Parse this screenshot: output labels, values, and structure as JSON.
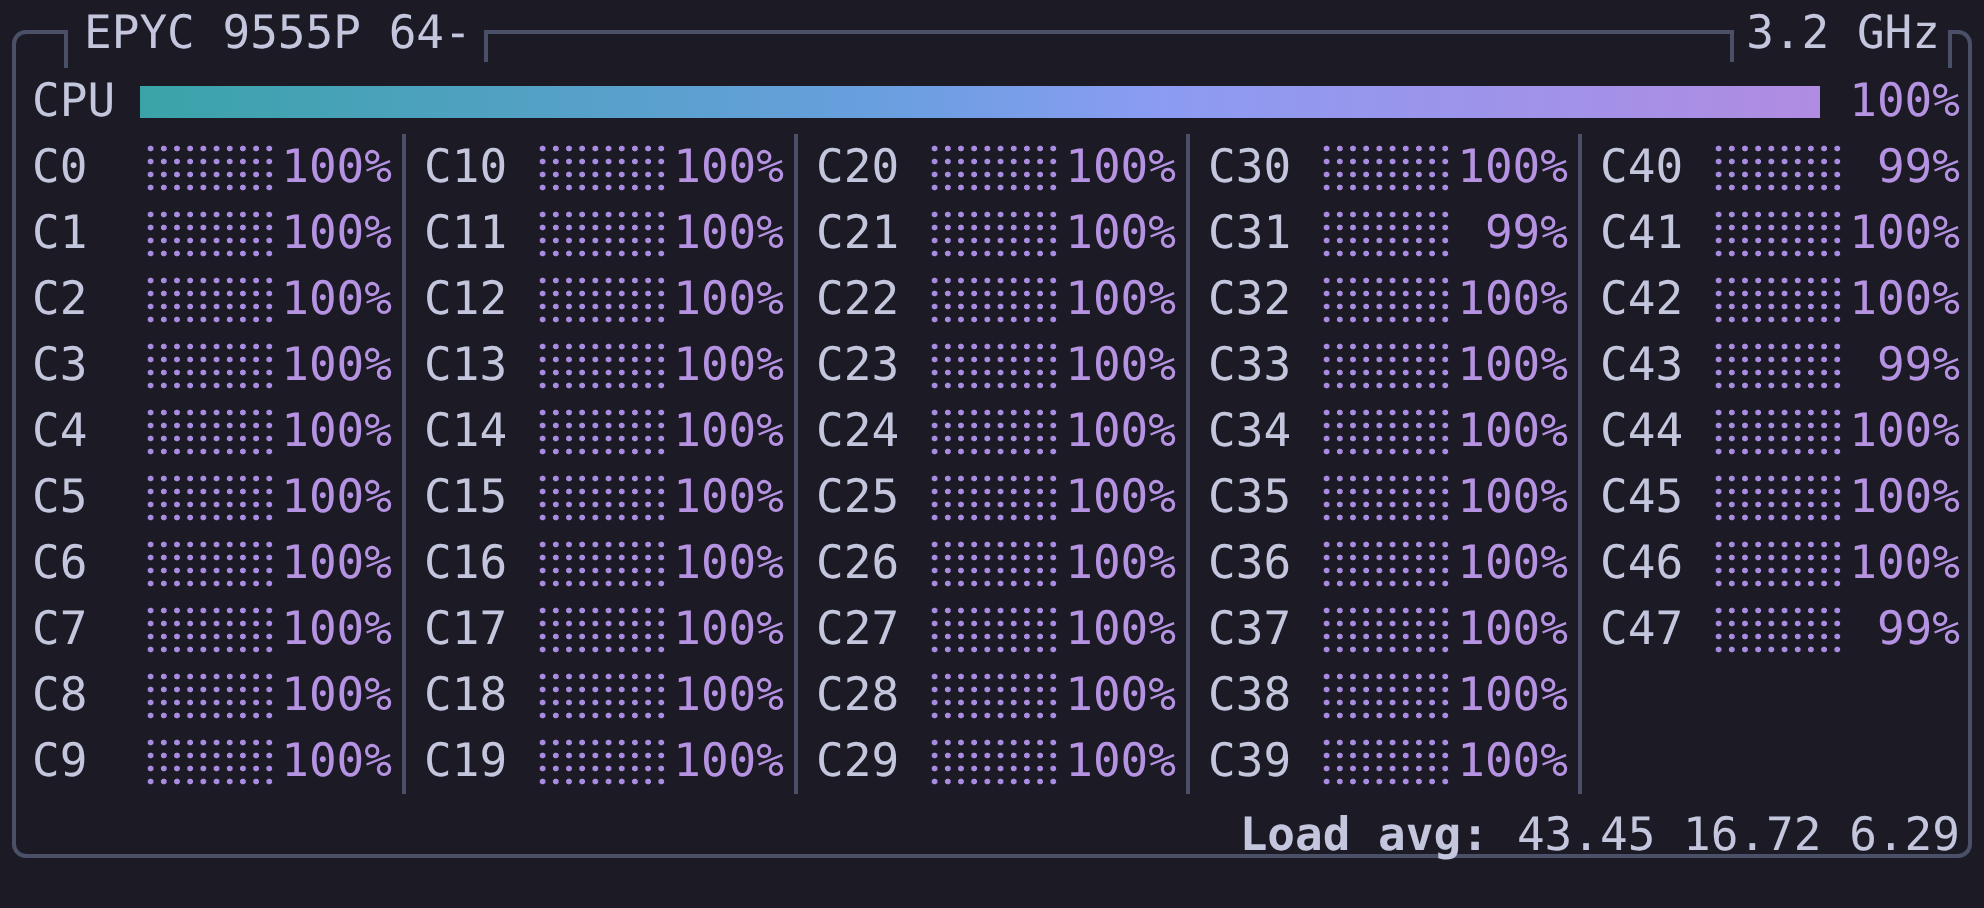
{
  "panel": {
    "title": "EPYC 9555P 64-",
    "frequency": "3.2 GHz"
  },
  "cpu": {
    "label": "CPU",
    "level": 1.0,
    "percent": "100%"
  },
  "cores": [
    {
      "label": "C0",
      "percent": "100%"
    },
    {
      "label": "C1",
      "percent": "100%"
    },
    {
      "label": "C2",
      "percent": "100%"
    },
    {
      "label": "C3",
      "percent": "100%"
    },
    {
      "label": "C4",
      "percent": "100%"
    },
    {
      "label": "C5",
      "percent": "100%"
    },
    {
      "label": "C6",
      "percent": "100%"
    },
    {
      "label": "C7",
      "percent": "100%"
    },
    {
      "label": "C8",
      "percent": "100%"
    },
    {
      "label": "C9",
      "percent": "100%"
    },
    {
      "label": "C10",
      "percent": "100%"
    },
    {
      "label": "C11",
      "percent": "100%"
    },
    {
      "label": "C12",
      "percent": "100%"
    },
    {
      "label": "C13",
      "percent": "100%"
    },
    {
      "label": "C14",
      "percent": "100%"
    },
    {
      "label": "C15",
      "percent": "100%"
    },
    {
      "label": "C16",
      "percent": "100%"
    },
    {
      "label": "C17",
      "percent": "100%"
    },
    {
      "label": "C18",
      "percent": "100%"
    },
    {
      "label": "C19",
      "percent": "100%"
    },
    {
      "label": "C20",
      "percent": "100%"
    },
    {
      "label": "C21",
      "percent": "100%"
    },
    {
      "label": "C22",
      "percent": "100%"
    },
    {
      "label": "C23",
      "percent": "100%"
    },
    {
      "label": "C24",
      "percent": "100%"
    },
    {
      "label": "C25",
      "percent": "100%"
    },
    {
      "label": "C26",
      "percent": "100%"
    },
    {
      "label": "C27",
      "percent": "100%"
    },
    {
      "label": "C28",
      "percent": "100%"
    },
    {
      "label": "C29",
      "percent": "100%"
    },
    {
      "label": "C30",
      "percent": "100%"
    },
    {
      "label": "C31",
      "percent": "99%"
    },
    {
      "label": "C32",
      "percent": "100%"
    },
    {
      "label": "C33",
      "percent": "100%"
    },
    {
      "label": "C34",
      "percent": "100%"
    },
    {
      "label": "C35",
      "percent": "100%"
    },
    {
      "label": "C36",
      "percent": "100%"
    },
    {
      "label": "C37",
      "percent": "100%"
    },
    {
      "label": "C38",
      "percent": "100%"
    },
    {
      "label": "C39",
      "percent": "100%"
    },
    {
      "label": "C40",
      "percent": "99%"
    },
    {
      "label": "C41",
      "percent": "100%"
    },
    {
      "label": "C42",
      "percent": "100%"
    },
    {
      "label": "C43",
      "percent": "99%"
    },
    {
      "label": "C44",
      "percent": "100%"
    },
    {
      "label": "C45",
      "percent": "100%"
    },
    {
      "label": "C46",
      "percent": "100%"
    },
    {
      "label": "C47",
      "percent": "99%"
    }
  ],
  "load_average": {
    "label": "Load avg:",
    "values": "43.45 16.72 6.29"
  }
}
